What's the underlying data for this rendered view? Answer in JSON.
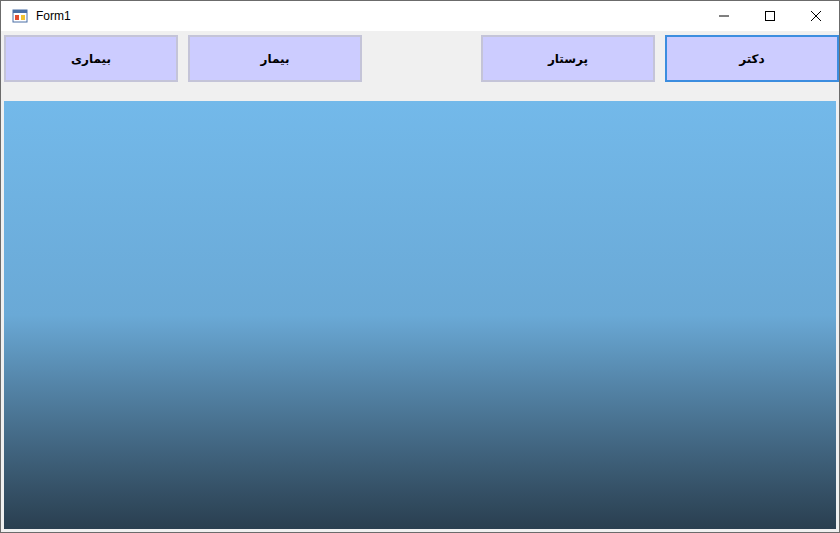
{
  "window": {
    "title": "Form1"
  },
  "toolbar": {
    "groups": [
      [
        {
          "label": "بیماری",
          "focused": false
        },
        {
          "label": "بیمار",
          "focused": false
        }
      ],
      [
        {
          "label": "پرستار",
          "focused": false
        },
        {
          "label": "دکتر",
          "focused": true
        }
      ]
    ]
  },
  "picture": {
    "kind": "illustration"
  }
}
